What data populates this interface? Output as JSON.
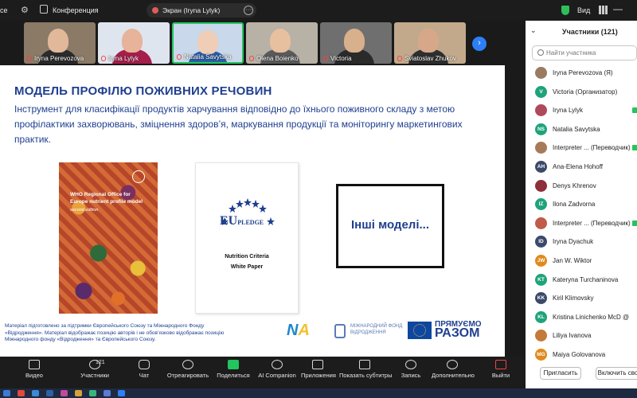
{
  "topbar": {
    "left_fragment": "ce",
    "conference_label": "Конференция",
    "screen_pill_label": "Экран (Iryna Lylyk)",
    "screen_pill_more": "···",
    "view_label": "Вид",
    "minimize": "—"
  },
  "thumbnails": [
    {
      "name": "Iryna Perevozova",
      "bg": "#8a7a66",
      "skin": "#e2b89a",
      "shirt": "#2b2b2b"
    },
    {
      "name": "Iryna Lylyk",
      "bg": "#dfe5ee",
      "skin": "#e7b39a",
      "shirt": "#a61e4a"
    },
    {
      "name": "Natalia Savytska",
      "bg": "#c9d8ea",
      "skin": "#f0cdb6",
      "shirt": "#2b5ea8"
    },
    {
      "name": "Olena Boienko",
      "bg": "#b7b1a6",
      "skin": "#e7c09f",
      "shirt": "#5a5a5a"
    },
    {
      "name": "Victoria",
      "bg": "#6f6f6f",
      "skin": "#d9b08c",
      "shirt": "#2a2a2a"
    },
    {
      "name": "Sviatoslav Zhukov",
      "bg": "#c2a98c",
      "skin": "#d6a889",
      "shirt": "#2f2f2f"
    }
  ],
  "strip_next": "›",
  "slide": {
    "title": "МОДЕЛЬ ПРОФІЛЮ ПОЖИВНИХ РЕЧОВИН",
    "description": "Інструмент для класифікації продуктів харчування відповідно до їхнього поживного складу з метою профілактики захворювань, зміцнення здоров’я, маркування продукції та моніторингу маркетингових практик.",
    "book_title": "WHO Regional Office for Europe nutrient profile model",
    "book_edition": "second edition",
    "eu_logo_main": "EU",
    "eu_logo_sub": "PLEDGE",
    "eu_nutrition": "Nutrition Criteria",
    "eu_white_paper": "White Paper",
    "other_models": "Інші моделі...",
    "disclaimer": "Матеріал підготовлено за підтримки Європейського Союзу та Міжнародного Фонду «Відродження». Матеріал відображає позицію авторів і не обов’язково відображає позицію Міжнародного фонду «Відродження» та Європейського Союзу.",
    "logo_fund": "МІЖНАРОДНИЙ ФОНД ВІДРОДЖЕННЯ",
    "logo_pr_small": "ПРЯМУЄМО",
    "logo_pr_big": "РАЗОМ"
  },
  "participants": {
    "title": "Участники (121)",
    "search_placeholder": "Найти участника",
    "list": [
      {
        "initials": "",
        "name": "Iryna Perevozova (Я)",
        "color": "#9a7b62",
        "badge": false
      },
      {
        "initials": "V",
        "name": "Victoria (Организатор)",
        "color": "#1fa37a",
        "badge": false
      },
      {
        "initials": "",
        "name": "Iryna Lylyk",
        "color": "#b04a5a",
        "badge": true
      },
      {
        "initials": "NS",
        "name": "Natalia Savytska",
        "color": "#1fa37a",
        "badge": false
      },
      {
        "initials": "",
        "name": "Interpreter ... (Переводчик)",
        "color": "#a77b5a",
        "badge": true
      },
      {
        "initials": "AH",
        "name": "Ana-Elena Hohoff",
        "color": "#3b4a6b",
        "badge": false
      },
      {
        "initials": "",
        "name": "Denys Khrenov",
        "color": "#8c2f3a",
        "badge": false
      },
      {
        "initials": "IZ",
        "name": "Ilona Zadvorna",
        "color": "#1fa37a",
        "badge": false
      },
      {
        "initials": "",
        "name": "Interpreter ... (Переводчик)",
        "color": "#c05a4a",
        "badge": true
      },
      {
        "initials": "ID",
        "name": "Iryna Dyachuk",
        "color": "#3b4a6b",
        "badge": false
      },
      {
        "initials": "JW",
        "name": "Jan W. Wiktor",
        "color": "#e08a1e",
        "badge": false
      },
      {
        "initials": "KT",
        "name": "Kateryna Turchaninova",
        "color": "#1fa37a",
        "badge": false
      },
      {
        "initials": "KK",
        "name": "Kiril Klimovsky",
        "color": "#3b4a6b",
        "badge": false
      },
      {
        "initials": "KL",
        "name": "Kristina Linichenko McD @",
        "color": "#1fa37a",
        "badge": false
      },
      {
        "initials": "",
        "name": "Liliya Ivanova",
        "color": "#c47a3a",
        "badge": false
      },
      {
        "initials": "MG",
        "name": "Maiya Golovanova",
        "color": "#e08a1e",
        "badge": false
      }
    ],
    "invite_label": "Пригласить",
    "unmute_label": "Включить сво"
  },
  "toolbar": {
    "video": "Видео",
    "participants": "Участники",
    "participants_count": "121",
    "chat": "Чат",
    "react": "Отреагировать",
    "share": "Поделиться",
    "ai": "AI Companion",
    "apps": "Приложения",
    "captions": "Показать субтитры",
    "record": "Запись",
    "more": "Дополнительно",
    "leave": "Выйти"
  },
  "colors": {
    "accent_blue": "#1f3f8f",
    "share_green": "#22c55e",
    "next_blue": "#2d7ff9"
  }
}
